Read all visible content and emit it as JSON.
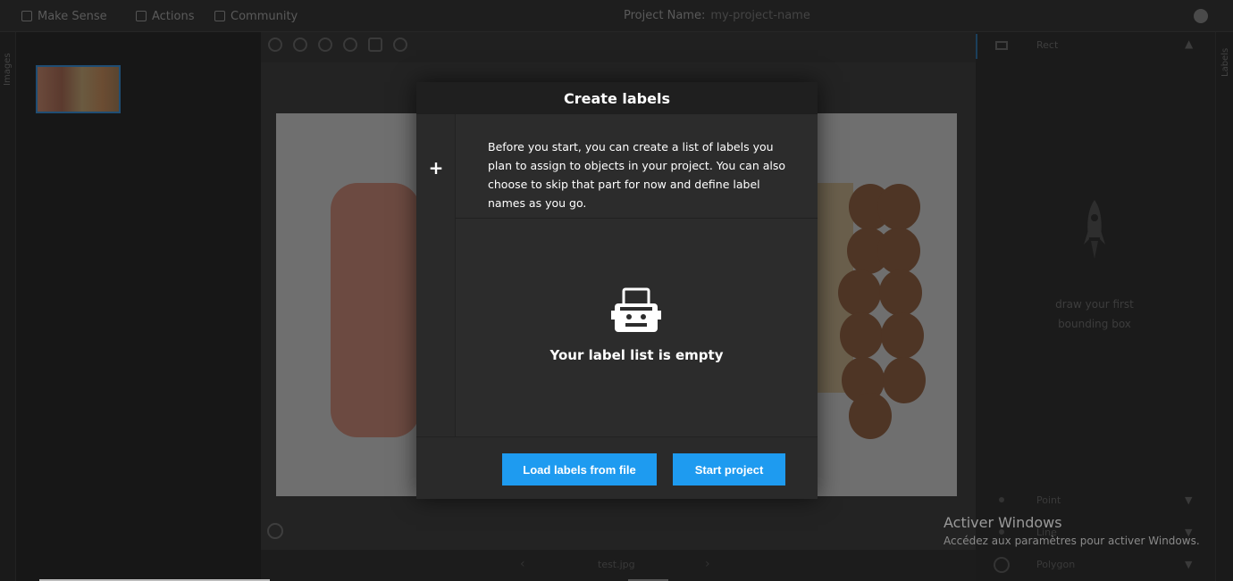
{
  "topbar": {
    "brand": "Make Sense",
    "actions": "Actions",
    "community": "Community",
    "project_label": "Project Name:",
    "project_value": "my-project-name"
  },
  "left_tab": {
    "label": "Images"
  },
  "right_tab": {
    "label": "Labels"
  },
  "editor": {
    "filename": "test.jpg"
  },
  "right_panel": {
    "rect_label": "Rect",
    "hint": "draw your first bounding box",
    "point_label": "Point",
    "line_label": "Line",
    "polygon_label": "Polygon"
  },
  "modal": {
    "title": "Create labels",
    "plus": "+",
    "intro": "Before you start, you can create a list of labels you plan to assign to objects in your project. You can also choose to skip that part for now and define label names as you go.",
    "empty": "Your label list is empty",
    "load_button": "Load labels from file",
    "start_button": "Start project"
  },
  "watermark": {
    "title": "Activer Windows",
    "subtitle": "Accédez aux paramètres pour activer Windows."
  },
  "colors": {
    "accent": "#1e9bf0",
    "modal_bg": "#2c2c2c",
    "modal_header": "#1f1f1f"
  }
}
